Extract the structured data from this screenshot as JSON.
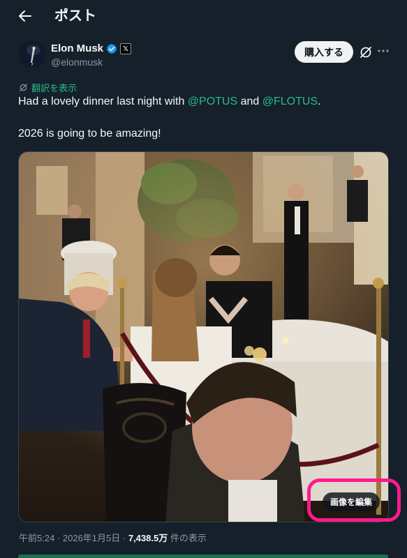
{
  "header": {
    "title": "ポスト"
  },
  "author": {
    "display_name": "Elon Musk",
    "handle": "@elonmusk",
    "subscribe_label": "購入する"
  },
  "translate_label": "翻訳を表示",
  "post": {
    "text_before": "Had a lovely dinner last night with ",
    "mention_1": "@POTUS",
    "text_middle": " and ",
    "mention_2": "@FLOTUS",
    "text_after": ".",
    "line2": "2026 is going to be amazing!"
  },
  "media": {
    "edit_label": "画像を編集"
  },
  "meta": {
    "time": "午前5:24",
    "sep1": " · ",
    "date": "2026年1月5日",
    "sep2": " · ",
    "views": "7,438.5万",
    "views_suffix": " 件の表示"
  },
  "colors": {
    "background": "#15202b",
    "accent_green": "#2dba87",
    "verified_blue": "#1d9bf0",
    "highlight_pink": "#ff1a8c"
  },
  "icons": [
    "back-arrow-icon",
    "verified-badge-icon",
    "x-affiliate-icon",
    "grok-icon",
    "more-icon",
    "translate-icon"
  ]
}
